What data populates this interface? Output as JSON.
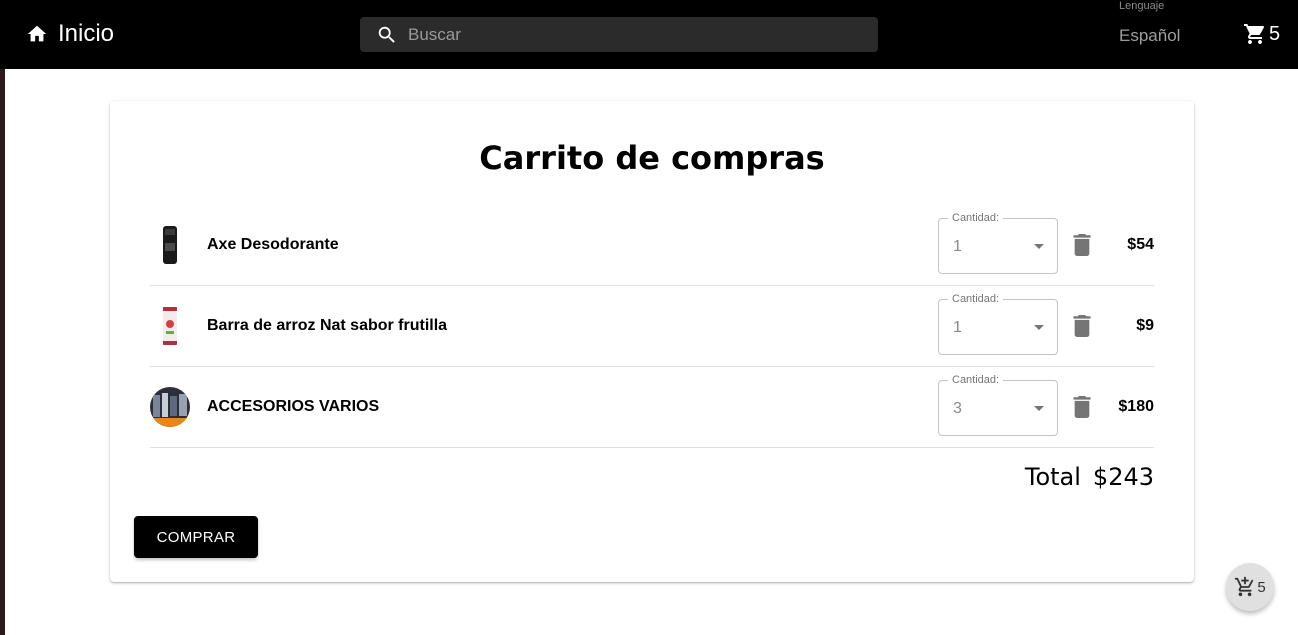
{
  "header": {
    "home_label": "Inicio",
    "search_placeholder": "Buscar",
    "language_label": "Lenguaje",
    "language_value": "Español",
    "cart_count": "5"
  },
  "cart": {
    "title": "Carrito de compras",
    "quantity_label": "Cantidad:",
    "items": [
      {
        "name": "Axe Desodorante",
        "quantity": "1",
        "price": "$54"
      },
      {
        "name": "Barra de arroz Nat sabor frutilla",
        "quantity": "1",
        "price": "$9"
      },
      {
        "name": "ACCESORIOS VARIOS",
        "quantity": "3",
        "price": "$180"
      }
    ],
    "total_label": "Total",
    "total_value": "$243",
    "buy_label": "COMPRAR"
  },
  "fab": {
    "count": "5"
  },
  "icons": [
    "home-icon",
    "search-icon",
    "cart-icon",
    "delete-icon",
    "add-to-cart-icon"
  ],
  "colors": {
    "topbar": "#000000",
    "button": "#000000",
    "muted": "#757575"
  }
}
